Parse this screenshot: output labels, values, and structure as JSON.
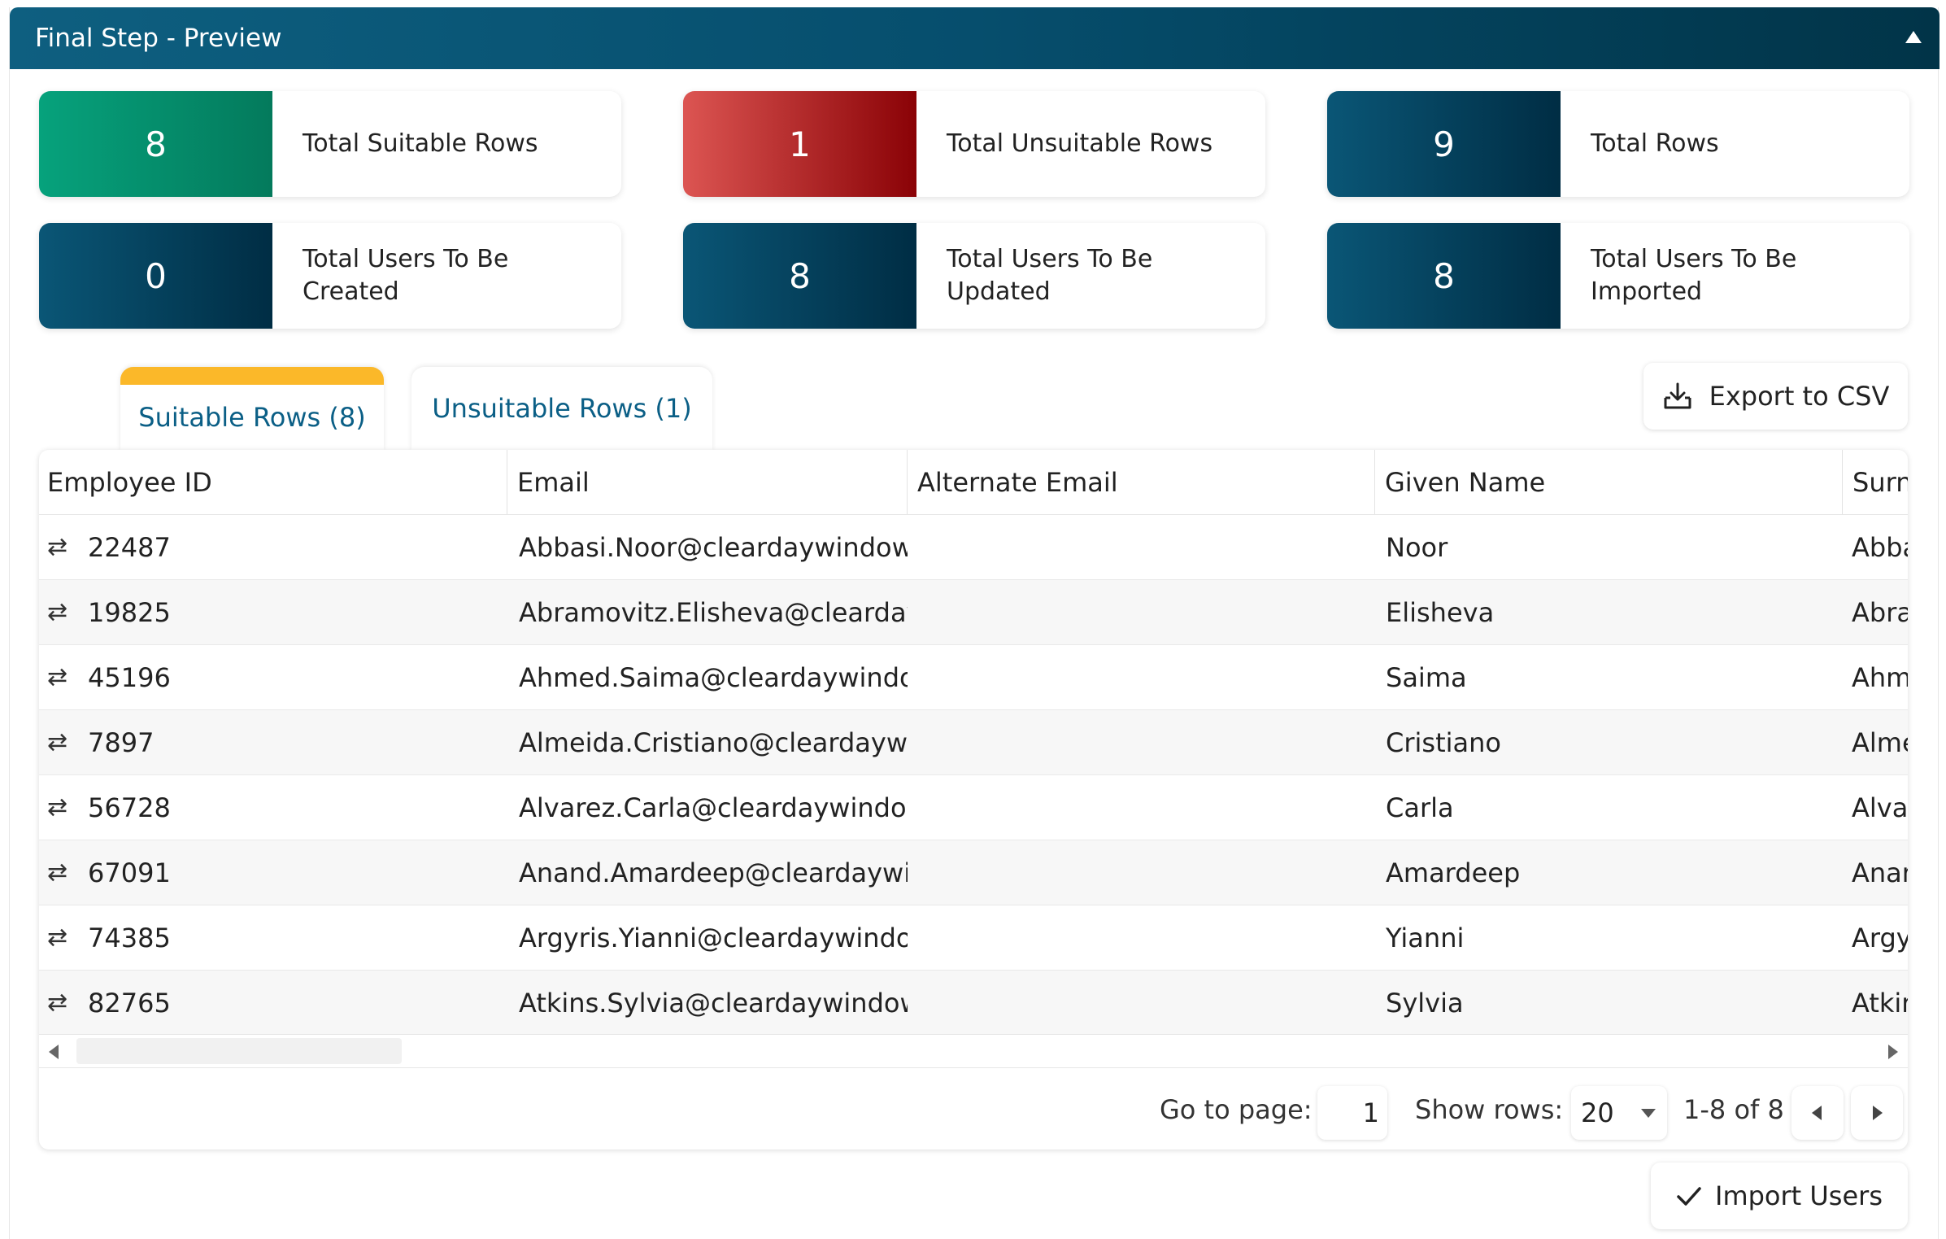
{
  "header": {
    "title": "Final Step - Preview",
    "collapse_icon": "chevron-up-icon"
  },
  "stats": [
    {
      "value": "8",
      "label": "Total Suitable Rows",
      "color": "#06a27c"
    },
    {
      "value": "1",
      "label": "Total Unsuitable Rows",
      "color": "#c0302f"
    },
    {
      "value": "9",
      "label": "Total Rows",
      "color": "#064e6d"
    },
    {
      "value": "0",
      "label": "Total Users To Be Created",
      "color": "#064e6d"
    },
    {
      "value": "8",
      "label": "Total Users To Be Updated",
      "color": "#064e6d"
    },
    {
      "value": "8",
      "label": "Total Users To Be Imported",
      "color": "#064e6d"
    }
  ],
  "tabs": [
    {
      "label": "Suitable Rows (8)",
      "active": true
    },
    {
      "label": "Unsuitable Rows (1)",
      "active": false
    }
  ],
  "actions": {
    "export_label": "Export to CSV",
    "import_label": "Import Users"
  },
  "table": {
    "columns": [
      "Employee ID",
      "Email",
      "Alternate Email",
      "Given Name",
      "Surn"
    ],
    "rows": [
      {
        "id": "22487",
        "email": "Abbasi.Noor@cleardaywindows",
        "alt": "",
        "given": "Noor",
        "surname": "Abba"
      },
      {
        "id": "19825",
        "email": "Abramovitz.Elisheva@cleardayw",
        "alt": "",
        "given": "Elisheva",
        "surname": "Abra"
      },
      {
        "id": "45196",
        "email": "Ahmed.Saima@cleardaywindow",
        "alt": "",
        "given": "Saima",
        "surname": "Ahm"
      },
      {
        "id": "7897",
        "email": "Almeida.Cristiano@cleardaywir",
        "alt": "",
        "given": "Cristiano",
        "surname": "Alme"
      },
      {
        "id": "56728",
        "email": "Alvarez.Carla@cleardaywindow",
        "alt": "",
        "given": "Carla",
        "surname": "Alvar"
      },
      {
        "id": "67091",
        "email": "Anand.Amardeep@cleardaywir",
        "alt": "",
        "given": "Amardeep",
        "surname": "Anar"
      },
      {
        "id": "74385",
        "email": "Argyris.Yianni@cleardaywindov",
        "alt": "",
        "given": "Yianni",
        "surname": "Argy"
      },
      {
        "id": "82765",
        "email": "Atkins.Sylvia@cleardaywindows",
        "alt": "",
        "given": "Sylvia",
        "surname": "Atkir"
      }
    ],
    "row_icon": "swap-arrows-icon"
  },
  "pagination": {
    "goto_label": "Go to page:",
    "page": "1",
    "rows_label": "Show rows:",
    "rows_value": "20",
    "range": "1-8 of 8"
  }
}
